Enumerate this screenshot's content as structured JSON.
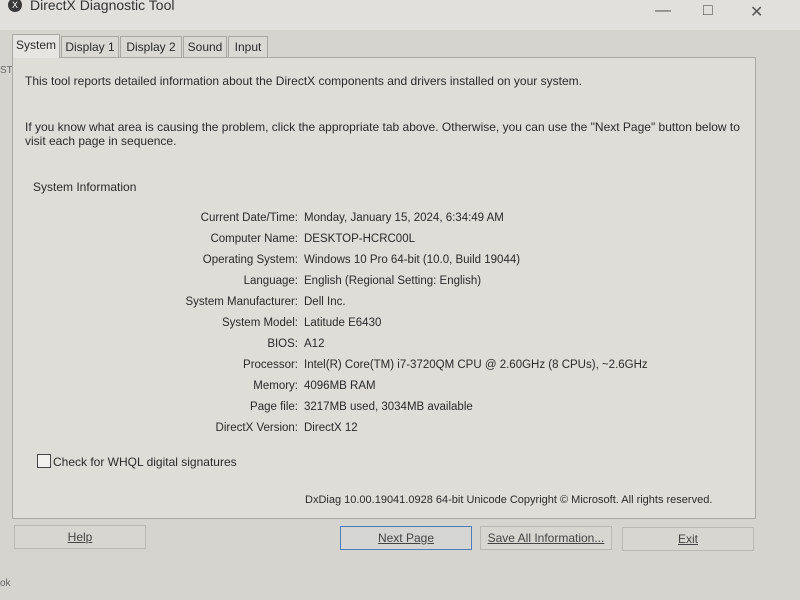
{
  "window": {
    "title": "DirectX Diagnostic Tool",
    "icon_glyph": "X",
    "minimize_glyph": "—",
    "maximize_glyph": "□",
    "close_glyph": "✕"
  },
  "tabs": [
    {
      "label": "System",
      "active": true
    },
    {
      "label": "Display 1",
      "active": false
    },
    {
      "label": "Display 2",
      "active": false
    },
    {
      "label": "Sound",
      "active": false
    },
    {
      "label": "Input",
      "active": false
    }
  ],
  "intro_line": "This tool reports detailed information about the DirectX components and drivers installed on your system.",
  "intro_help": "If you know what area is causing the problem, click the appropriate tab above.  Otherwise, you can use the \"Next Page\" button below to visit each page in sequence.",
  "section_title": "System Information",
  "info": [
    {
      "label": "Current Date/Time:",
      "value": "Monday, January 15, 2024, 6:34:49 AM"
    },
    {
      "label": "Computer Name:",
      "value": "DESKTOP-HCRC00L"
    },
    {
      "label": "Operating System:",
      "value": "Windows 10 Pro 64-bit (10.0, Build 19044)"
    },
    {
      "label": "Language:",
      "value": "English (Regional Setting: English)"
    },
    {
      "label": "System Manufacturer:",
      "value": "Dell Inc."
    },
    {
      "label": "System Model:",
      "value": "Latitude E6430"
    },
    {
      "label": "BIOS:",
      "value": "A12"
    },
    {
      "label": "Processor:",
      "value": "Intel(R) Core(TM) i7-3720QM CPU @ 2.60GHz (8 CPUs), ~2.6GHz"
    },
    {
      "label": "Memory:",
      "value": "4096MB RAM"
    },
    {
      "label": "Page file:",
      "value": "3217MB used, 3034MB available"
    },
    {
      "label": "DirectX Version:",
      "value": "DirectX 12"
    }
  ],
  "whql_checkbox": {
    "label": "Check for WHQL digital signatures",
    "checked": false
  },
  "copyright": "DxDiag 10.00.19041.0928 64-bit Unicode  Copyright © Microsoft. All rights reserved.",
  "buttons": {
    "help": "Help",
    "next_page": "Next Page",
    "save_all": "Save All Information...",
    "exit": "Exit"
  },
  "edge_left": "ST",
  "edge_bottom": "ok"
}
